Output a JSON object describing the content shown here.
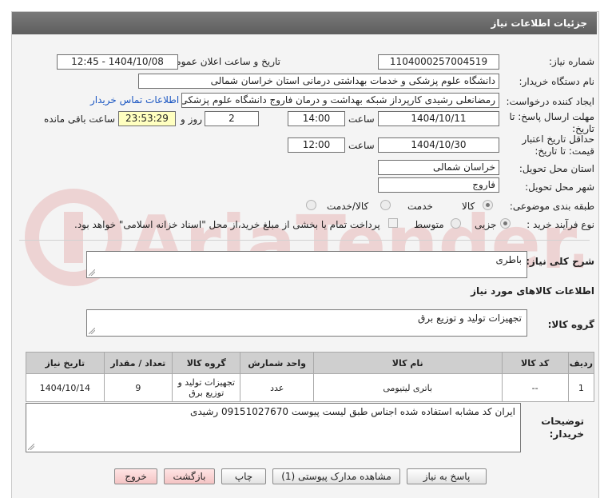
{
  "header": {
    "title": "جزئیات اطلاعات نیاز"
  },
  "fields": {
    "need_number_label": "شماره نیاز:",
    "need_number": "1104000257004519",
    "announce_label": "تاریخ و ساعت اعلان عمومی:",
    "announce_value": "1404/10/08 - 12:45",
    "buyer_org_label": "نام دستگاه خریدار:",
    "buyer_org": "دانشگاه علوم پزشکی و خدمات بهداشتی درمانی استان خراسان شمالی",
    "creator_label": "ایجاد کننده درخواست:",
    "creator": "رمضانعلی رشیدی کارپرداز شبکه بهداشت و درمان فاروج دانشگاه علوم پزشکی",
    "contact_link": "اطلاعات تماس خریدار",
    "reply_deadline_label_1": "مهلت ارسال پاسخ: تا",
    "reply_deadline_label_2": "تاریخ:",
    "reply_date": "1404/10/11",
    "time_label": "ساعت",
    "reply_time": "14:00",
    "days_value": "2",
    "days_label": "روز و",
    "remaining_time": "23:53:29",
    "remaining_label": "ساعت باقی مانده",
    "price_validity_label_1": "حداقل تاریخ اعتبار",
    "price_validity_label_2": "قیمت: تا تاریخ:",
    "price_date": "1404/10/30",
    "price_time": "12:00",
    "province_label": "استان محل تحویل:",
    "province": "خراسان شمالی",
    "city_label": "شهر محل تحویل:",
    "city": "فاروج",
    "category_label": "طبقه بندی موضوعی:",
    "category_options": [
      "کالا",
      "خدمت",
      "کالا/خدمت"
    ],
    "process_label": "نوع فرآیند خرید :",
    "process_options": [
      "جزیی",
      "متوسط"
    ],
    "payment_note": "پرداخت تمام یا بخشی از مبلغ خرید،از محل \"اسناد خزانه اسلامی\" خواهد بود."
  },
  "description": {
    "label": "شرح کلی نیاز:",
    "value": "باطری"
  },
  "goods_section": {
    "title": "اطلاعات کالاهای مورد نیاز",
    "group_label": "گروه کالا:",
    "group_value": "تجهیزات تولید و توزیع برق"
  },
  "table": {
    "headers": [
      "ردیف",
      "کد کالا",
      "نام کالا",
      "واحد شمارش",
      "گروه کالا",
      "تعداد / مقدار",
      "تاریخ نیاز"
    ],
    "rows": [
      [
        "1",
        "--",
        "باتری لیتیومی",
        "عدد",
        "تجهیزات تولید و توزیع برق",
        "9",
        "1404/10/14"
      ]
    ]
  },
  "buyer_notes": {
    "label_1": "توضیحات",
    "label_2": "خریدار:",
    "value": "ایران کد مشابه استفاده شده اجناس طبق لیست پیوست 09151027670 رشیدی"
  },
  "buttons": {
    "reply": "پاسخ به نیاز",
    "attachments": "مشاهده مدارک پیوستی (1)",
    "print": "چاپ",
    "back": "بازگشت",
    "exit": "خروج"
  },
  "watermark": {
    "text": "AriaTender.net"
  },
  "colors": {
    "titlebar": "#6a6a6a",
    "link": "#1a56c2",
    "remaining_bg": "#ffffc0",
    "panel": "#f4f4f4"
  }
}
